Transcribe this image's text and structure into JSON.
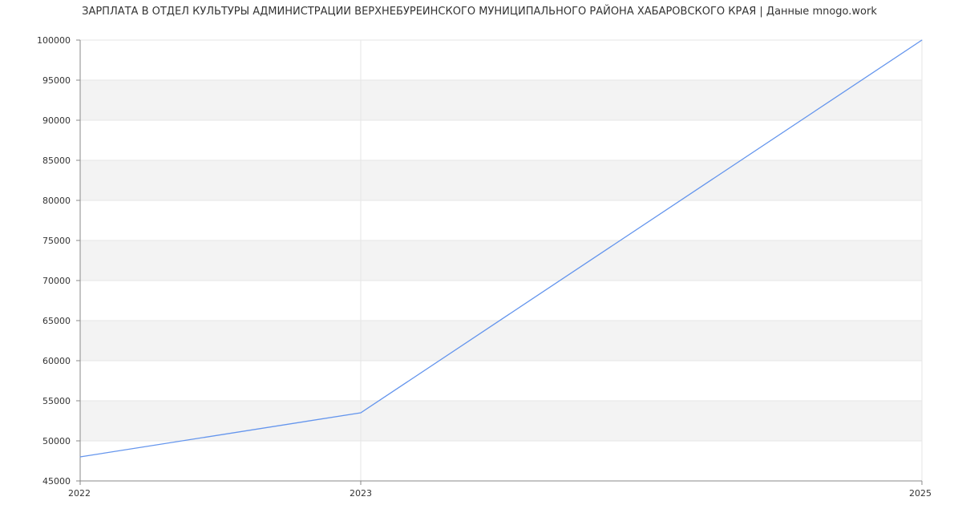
{
  "chart_data": {
    "type": "line",
    "title": "ЗАРПЛАТА В ОТДЕЛ КУЛЬТУРЫ АДМИНИСТРАЦИИ ВЕРХНЕБУРЕИНСКОГО МУНИЦИПАЛЬНОГО РАЙОНА ХАБАРОВСКОГО КРАЯ | Данные mnogo.work",
    "xlabel": "",
    "ylabel": "",
    "x": [
      2022,
      2023,
      2025
    ],
    "x_tick_labels": [
      "2022",
      "2023",
      "2025"
    ],
    "series": [
      {
        "values": [
          48000,
          53500,
          100000
        ]
      }
    ],
    "ylim": [
      45000,
      100000
    ],
    "y_ticks": [
      45000,
      50000,
      55000,
      60000,
      65000,
      70000,
      75000,
      80000,
      85000,
      90000,
      95000,
      100000
    ],
    "grid": true,
    "legend": "none",
    "colors": {
      "line": "#6495ED",
      "band": "#f3f3f3",
      "grid": "#e6e6e6",
      "axis": "#888888",
      "text": "#333333"
    }
  }
}
